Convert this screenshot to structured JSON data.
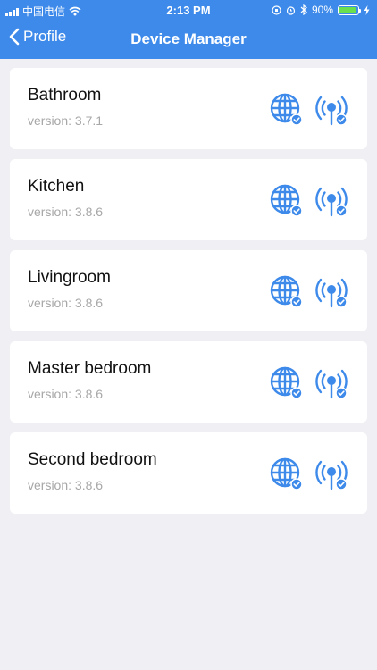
{
  "status_bar": {
    "carrier": "中国电信",
    "time": "2:13 PM",
    "battery": "90%",
    "battery_level": 0.9
  },
  "nav": {
    "back_label": "Profile",
    "title": "Device Manager"
  },
  "devices": [
    {
      "name": "Bathroom",
      "version": "version: 3.7.1"
    },
    {
      "name": "Kitchen",
      "version": "version: 3.8.6"
    },
    {
      "name": "Livingroom",
      "version": "version: 3.8.6"
    },
    {
      "name": "Master bedroom",
      "version": "version: 3.8.6"
    },
    {
      "name": "Second bedroom",
      "version": "version: 3.8.6"
    }
  ],
  "icons": {
    "network": "globe-connected-icon",
    "wireless": "wireless-connected-icon"
  },
  "colors": {
    "header": "#3d8aea",
    "accent": "#3d8aea",
    "background": "#efeff4"
  }
}
